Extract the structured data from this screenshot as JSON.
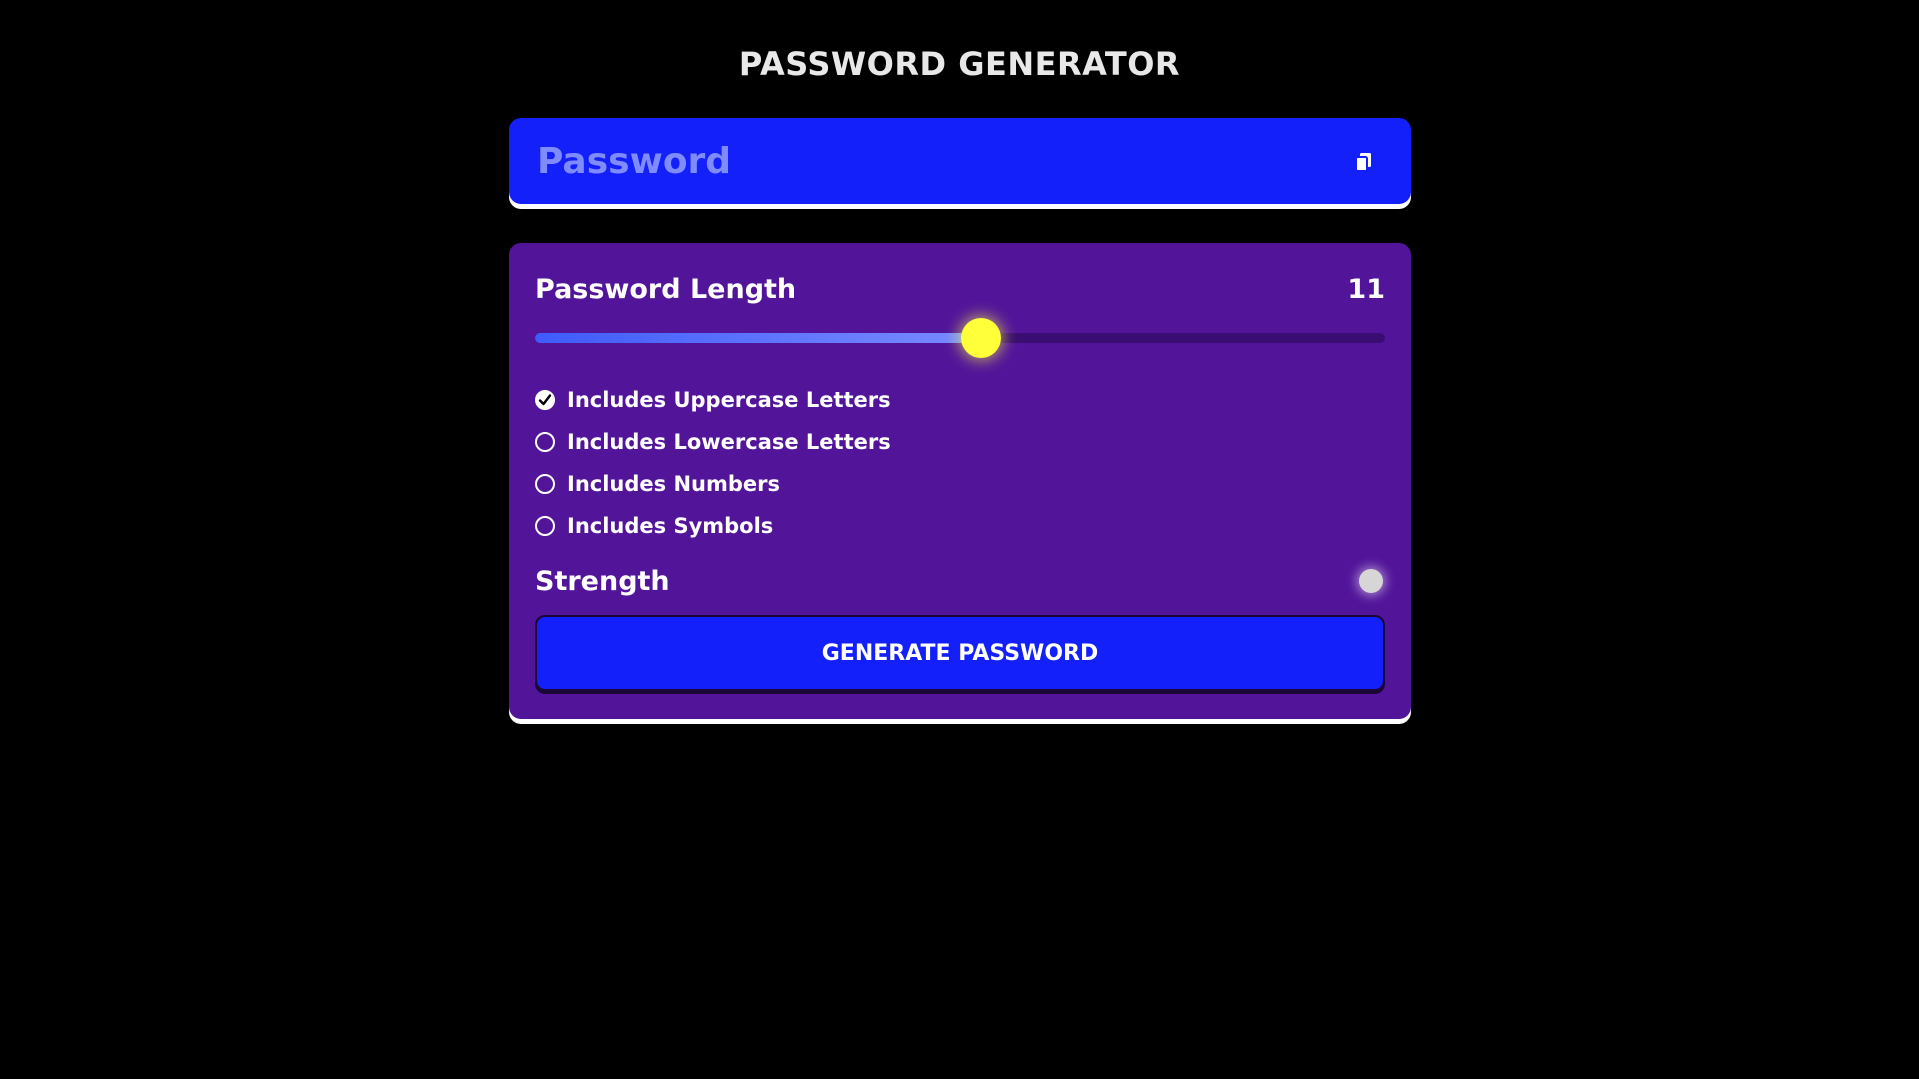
{
  "header": {
    "title": "PASSWORD GENERATOR"
  },
  "display": {
    "placeholder": "Password",
    "value": "",
    "copy_icon": "copy-icon"
  },
  "length": {
    "label": "Password Length",
    "value": "11",
    "slider_fraction": 0.525
  },
  "options": [
    {
      "label": "Includes Uppercase Letters",
      "checked": true
    },
    {
      "label": "Includes Lowercase Letters",
      "checked": false
    },
    {
      "label": "Includes Numbers",
      "checked": false
    },
    {
      "label": "Includes Symbols",
      "checked": false
    }
  ],
  "strength": {
    "label": "Strength",
    "indicator_color": "#d6d6d6"
  },
  "generate": {
    "label": "GENERATE PASSWORD"
  },
  "colors": {
    "background": "#000000",
    "display_bg": "#1420fa",
    "panel_bg": "#52159a",
    "thumb": "#ffff3a",
    "button_bg": "#1420fa"
  }
}
